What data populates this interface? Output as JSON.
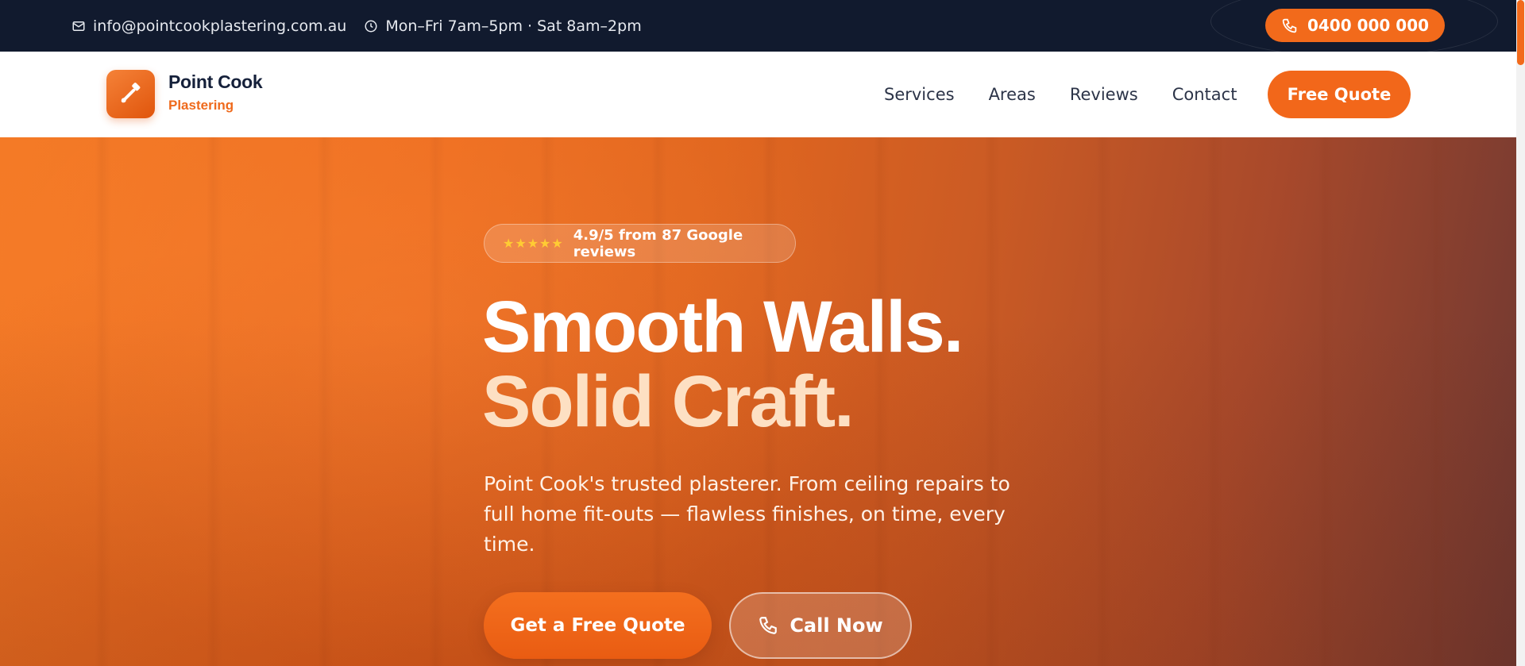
{
  "topbar": {
    "email": "info@pointcookplastering.com.au",
    "hours": "Mon–Fri 7am–5pm · Sat 8am–2pm",
    "phone": "0400 000 000"
  },
  "brand": {
    "name_line1": "Point Cook",
    "name_line2": "Plastering"
  },
  "nav": {
    "items": [
      {
        "label": "Services"
      },
      {
        "label": "Areas"
      },
      {
        "label": "Reviews"
      },
      {
        "label": "Contact"
      }
    ],
    "cta_label": "Free Quote"
  },
  "hero": {
    "rating_stars": "★★★★★",
    "rating_text": "4.9/5 from 87 Google reviews",
    "headline_line1": "Smooth Walls.",
    "headline_line2": "Solid Craft.",
    "subtext": "Point Cook's trusted plasterer. From ceiling repairs to full home fit-outs — flawless finishes, on time, every time.",
    "primary_cta": "Get a Free Quote",
    "secondary_cta": "Call Now"
  },
  "icons": {
    "email": "mail-icon",
    "hours": "clock-icon",
    "phone": "phone-icon",
    "logo": "plaster-trowel-icon"
  },
  "colors": {
    "accent": "#f26a1b",
    "topbar_bg": "#111a2e",
    "brand_text": "#15203a",
    "headline_highlight": "#fde0c3",
    "star": "#ffcc33"
  }
}
